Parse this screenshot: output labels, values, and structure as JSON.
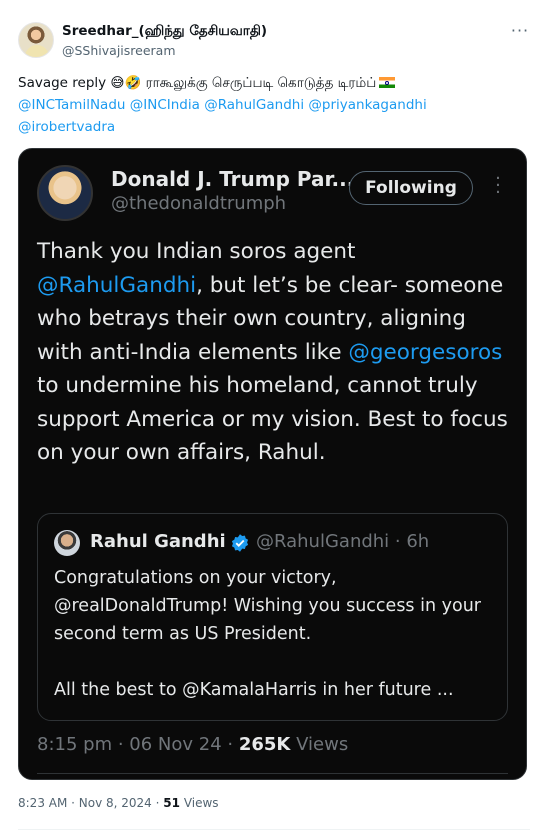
{
  "tweet": {
    "author_name": "Sreedhar_(ஹிந்து தேசியவாதி)",
    "author_handle": "@SShivajisreeram",
    "text_prefix": "Savage reply 😅🤣 ராகூலுக்கு செருப்படி கொடுத்த டிரம்ப்",
    "mentions": [
      "@INCTamilNadu",
      "@INCIndia",
      "@RahulGandhi",
      "@priyankagandhi",
      "@irobertvadra"
    ],
    "time": "8:23 AM",
    "date": "Nov 8, 2024",
    "views_count": "51",
    "views_label": "Views"
  },
  "screenshot": {
    "author_name": "Donald J. Trump Par...",
    "author_handle": "@thedonaldtrumph",
    "follow_button": "Following",
    "text": {
      "part1": "Thank you Indian soros agent ",
      "mention1": "@RahulGandhi",
      "part2": ", but let’s be clear- someone who betrays their own country, aligning with anti-India elements like ",
      "mention2": "@georgesoros",
      "part3": " to undermine his homeland, cannot truly support America or my vision. Best to focus on your own affairs, Rahul."
    },
    "quote": {
      "author_name": "Rahul Gandhi",
      "author_handle": "@RahulGandhi · 6h",
      "line1": "Congratulations on your victory, @realDonaldTrump! Wishing you success in your second term as US President.",
      "line2": "All the best to @KamalaHarris in her future ..."
    },
    "time": "8:15 pm",
    "date": "06 Nov 24",
    "views_count": "265K",
    "views_label": "Views"
  },
  "icons": {
    "more": "more-horizontal-icon",
    "verified": "verified-badge-icon",
    "flag": "india-flag-icon"
  },
  "colors": {
    "link": "#1d9bf0",
    "verified": "#1d9bf0",
    "dark_bg": "#0a0a0a"
  }
}
